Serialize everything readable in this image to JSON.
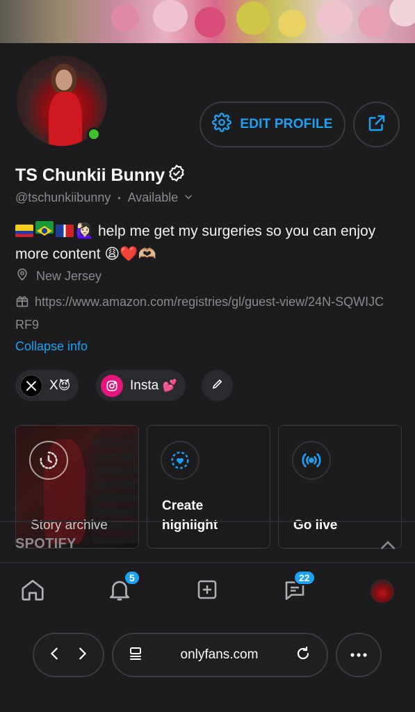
{
  "profile": {
    "name": "TS Chunkii Bunny",
    "handle": "@tschunkiibunny",
    "separator": "•",
    "status": "Available",
    "bio_line1": "help me get my surgeries so you can enjoy",
    "bio_line2": "more content",
    "location": "New Jersey",
    "wishlist_url": "https://www.amazon.com/registries/gl/guest-view/24N-SQWIJCRF9",
    "collapse_label": "Collapse info",
    "edit_label": "EDIT PROFILE"
  },
  "social_links": [
    {
      "label": "X",
      "icon": "x-logo-icon"
    },
    {
      "label": "Insta",
      "icon": "instagram-icon"
    }
  ],
  "emoji": {
    "x_chip": "😈",
    "insta_chip": "💕",
    "bio_hand": "🙋🏻‍♀️",
    "bio_end": "😩❤️🫶🏼"
  },
  "cards": [
    {
      "label": "Story archive",
      "icon": "clock-history-icon"
    },
    {
      "label": "Create highlight",
      "icon": "heart-plus-icon"
    },
    {
      "label": "Go live",
      "icon": "broadcast-icon"
    }
  ],
  "sections": {
    "spotify": "SPOTIFY"
  },
  "nav": {
    "notifications_badge": "5",
    "messages_badge": "22"
  },
  "browser": {
    "url": "onlyfans.com"
  },
  "colors": {
    "accent": "#1da1f2",
    "online": "#3ec12d",
    "background": "#1c1c1e",
    "instagram": "#e4157c"
  }
}
